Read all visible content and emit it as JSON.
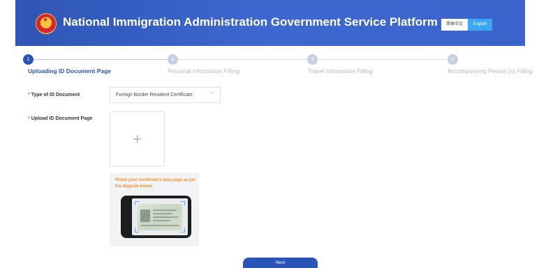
{
  "header": {
    "title": "National Immigration Administration Government Service Platform",
    "emblem_icon": "national-emblem-icon",
    "lang_cn": "简体中文",
    "lang_en": "English",
    "active_lang": "English"
  },
  "steps": [
    {
      "num": "1",
      "label": "Uploading ID Document Page",
      "active": true
    },
    {
      "num": "2",
      "label": "Personal Information Filling",
      "active": false
    },
    {
      "num": "3",
      "label": "Travel Information Filling",
      "active": false
    },
    {
      "num": "4",
      "label": "Accompanying Person (s) Filling",
      "active": false
    }
  ],
  "form": {
    "required_mark": "*",
    "doc_type_label": "Type of ID Document",
    "doc_type_value": "Foreign Border Resident Certificate",
    "upload_label": "Upload ID Document Page",
    "upload_plus": "+",
    "hint": "Photo your certificate's data page as per the diagram below."
  },
  "actions": {
    "next_label": "Next"
  },
  "colors": {
    "primary": "#2a54b8",
    "header_blue": "#3a64cc",
    "english_button": "#3aa7f3",
    "hint_orange": "#f5902a",
    "required_red": "#e34b4b"
  }
}
